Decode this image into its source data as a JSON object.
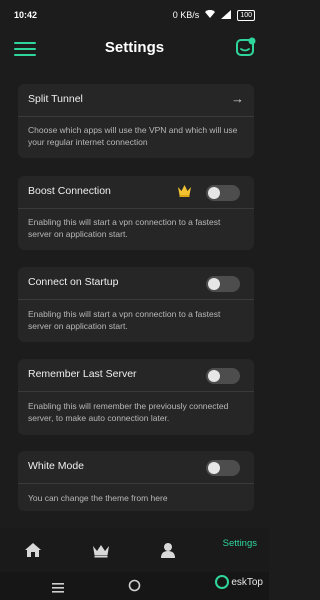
{
  "status": {
    "time": "10:42",
    "net": "0 KB/s",
    "battery": "100"
  },
  "header": {
    "title": "Settings"
  },
  "cards": [
    {
      "label": "Split Tunnel",
      "desc": "Choose which apps will use the VPN and which will use your regular internet connection"
    },
    {
      "label": "Boost Connection",
      "desc": "Enabling this will start a vpn connection to a fastest server on application start.",
      "toggle_on": false
    },
    {
      "label": "Connect on Startup",
      "desc": "Enabling this will start a vpn connection to a fastest server on application start.",
      "toggle_on": false
    },
    {
      "label": "Remember Last Server",
      "desc": "Enabling this will remember the previously connected server, to make auto connection later.",
      "toggle_on": false
    },
    {
      "label": "White Mode",
      "desc": "You can change the theme from here",
      "toggle_on": false
    }
  ],
  "nav": {
    "settings_label": "Settings"
  },
  "watermark": {
    "text": "eskTop"
  },
  "colors": {
    "accent": "#2fd69b",
    "crown": "#f2c230",
    "background": "#1c1c1c",
    "card": "#262626"
  }
}
